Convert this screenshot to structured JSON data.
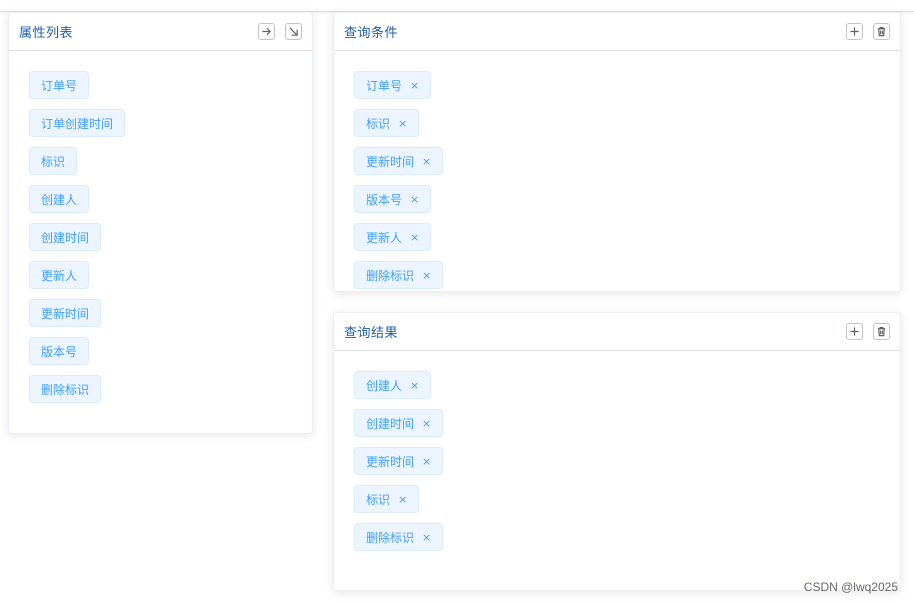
{
  "attributes_panel": {
    "title": "属性列表",
    "items": [
      "订单号",
      "订单创建时间",
      "标识",
      "创建人",
      "创建时间",
      "更新人",
      "更新时间",
      "版本号",
      "删除标识"
    ]
  },
  "query_conditions_panel": {
    "title": "查询条件",
    "items": [
      "订单号",
      "标识",
      "更新时间",
      "版本号",
      "更新人",
      "删除标识"
    ]
  },
  "query_results_panel": {
    "title": "查询结果",
    "items": [
      "创建人",
      "创建时间",
      "更新时间",
      "标识",
      "删除标识"
    ]
  },
  "tag_close_glyph": "×",
  "icons": {
    "attributes_panel": [
      "arrow-right-icon",
      "arrow-down-right-icon"
    ],
    "query_panels": [
      "plus-icon",
      "trash-icon"
    ]
  },
  "colors": {
    "tag_bg": "#ecf5ff",
    "tag_border": "#d9ecff",
    "tag_text": "#409eff",
    "title_text": "#1f5fa8"
  },
  "watermark": "CSDN @lwq2025"
}
